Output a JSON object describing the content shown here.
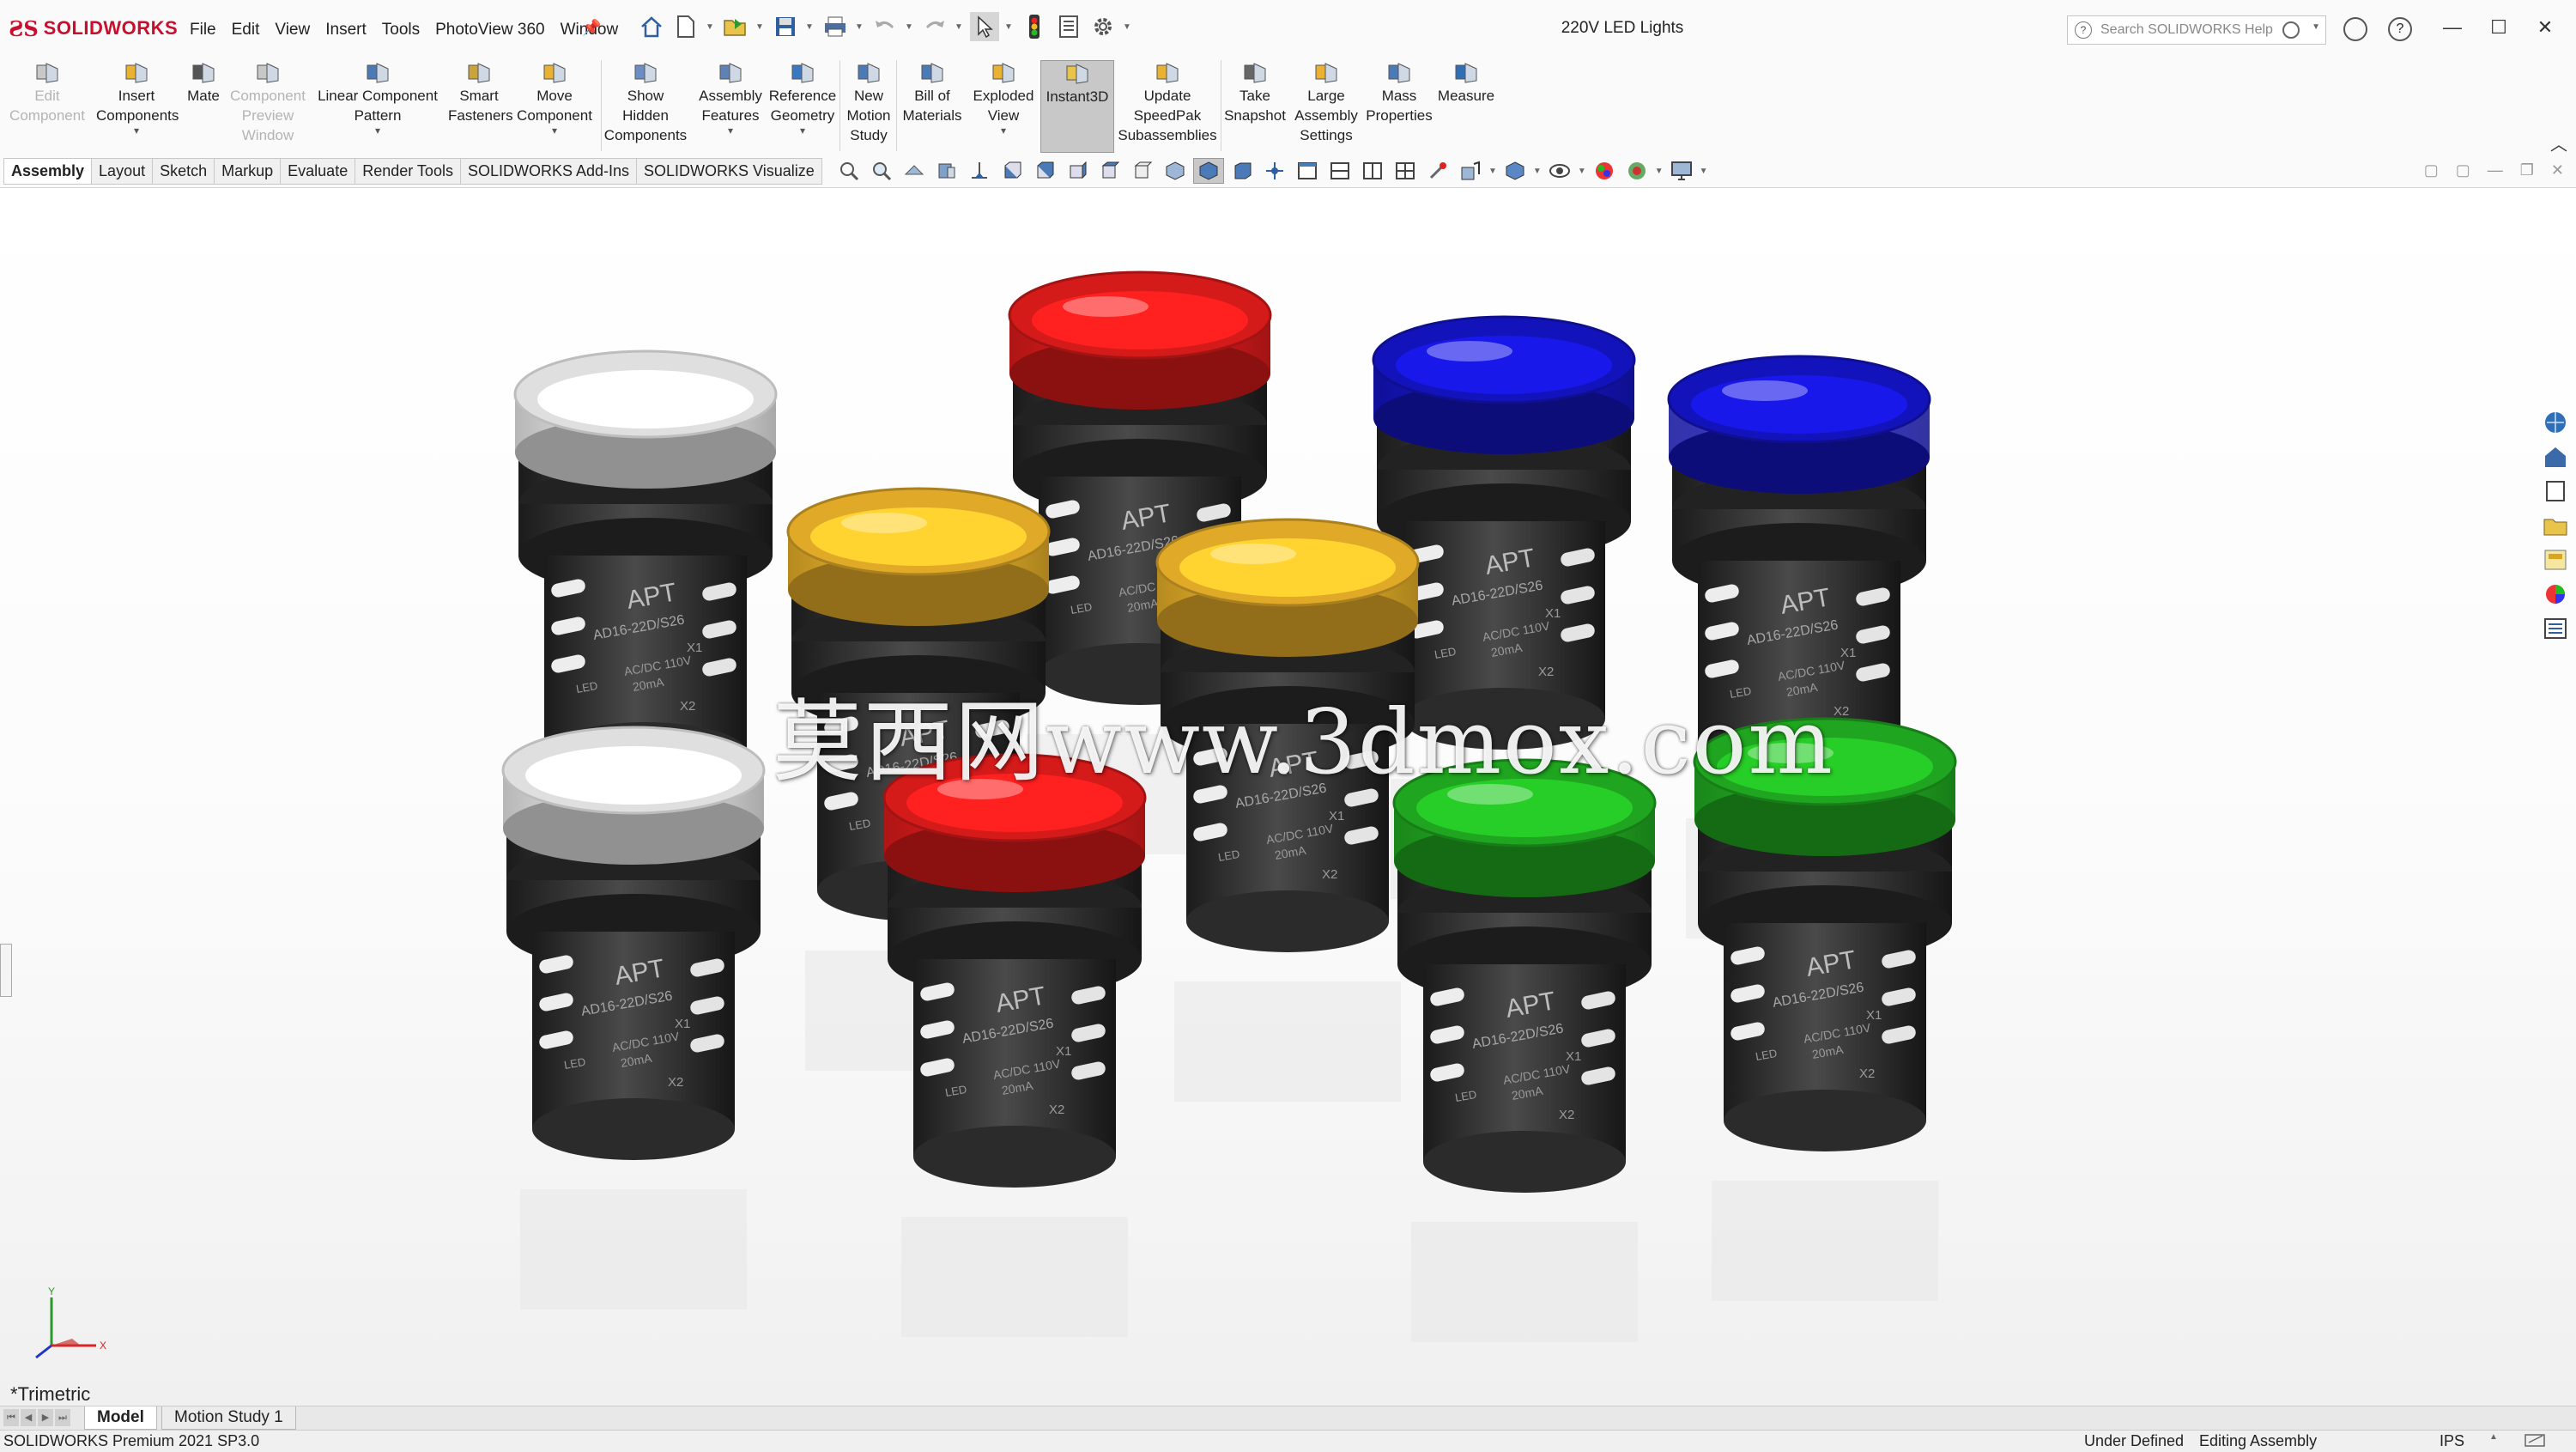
{
  "app": {
    "brand": "SOLIDWORKS",
    "doc_title": "220V LED Lights"
  },
  "menu": [
    "File",
    "Edit",
    "View",
    "Insert",
    "Tools",
    "PhotoView 360",
    "Window"
  ],
  "search": {
    "placeholder": "Search SOLIDWORKS Help"
  },
  "command_manager": [
    {
      "id": "edit-component",
      "lines": [
        "Edit",
        "Component"
      ],
      "disabled": true,
      "icon": "edit-component-icon"
    },
    {
      "id": "insert-components",
      "lines": [
        "Insert",
        "Components"
      ],
      "dropdown": true,
      "icon": "insert-components-icon"
    },
    {
      "id": "mate",
      "lines": [
        "Mate"
      ],
      "icon": "mate-paperclip-icon"
    },
    {
      "id": "component-preview-window",
      "lines": [
        "Component",
        "Preview",
        "Window"
      ],
      "disabled": true,
      "icon": "component-preview-icon"
    },
    {
      "id": "linear-component-pattern",
      "lines": [
        "Linear Component",
        "Pattern"
      ],
      "dropdown": true,
      "icon": "linear-pattern-icon"
    },
    {
      "id": "smart-fasteners",
      "lines": [
        "Smart",
        "Fasteners"
      ],
      "icon": "smart-fasteners-icon"
    },
    {
      "id": "move-component",
      "lines": [
        "Move",
        "Component"
      ],
      "dropdown": true,
      "icon": "move-component-icon"
    },
    {
      "id": "show-hidden-components",
      "lines": [
        "Show",
        "Hidden",
        "Components"
      ],
      "icon": "show-hidden-icon"
    },
    {
      "id": "assembly-features",
      "lines": [
        "Assembly",
        "Features"
      ],
      "dropdown": true,
      "icon": "assembly-features-icon"
    },
    {
      "id": "reference-geometry",
      "lines": [
        "Reference",
        "Geometry"
      ],
      "dropdown": true,
      "icon": "reference-geometry-icon"
    },
    {
      "id": "new-motion-study",
      "lines": [
        "New",
        "Motion",
        "Study"
      ],
      "icon": "motion-study-icon"
    },
    {
      "id": "bill-of-materials",
      "lines": [
        "Bill of",
        "Materials"
      ],
      "icon": "bom-icon"
    },
    {
      "id": "exploded-view",
      "lines": [
        "Exploded",
        "View"
      ],
      "dropdown": true,
      "icon": "exploded-view-icon"
    },
    {
      "id": "instant3d",
      "lines": [
        "Instant3D"
      ],
      "active": true,
      "icon": "instant3d-icon"
    },
    {
      "id": "update-speedpak",
      "lines": [
        "Update",
        "SpeedPak",
        "Subassemblies"
      ],
      "icon": "speedpak-icon"
    },
    {
      "id": "take-snapshot",
      "lines": [
        "Take",
        "Snapshot"
      ],
      "icon": "camera-icon"
    },
    {
      "id": "large-assembly-settings",
      "lines": [
        "Large",
        "Assembly",
        "Settings"
      ],
      "icon": "large-assembly-icon"
    },
    {
      "id": "mass-properties",
      "lines": [
        "Mass",
        "Properties"
      ],
      "icon": "scale-icon"
    },
    {
      "id": "measure",
      "lines": [
        "Measure"
      ],
      "icon": "measure-icon"
    }
  ],
  "tabs": [
    "Assembly",
    "Layout",
    "Sketch",
    "Markup",
    "Evaluate",
    "Render Tools",
    "SOLIDWORKS Add-Ins",
    "SOLIDWORKS Visualize"
  ],
  "active_tab": "Assembly",
  "viewport": {
    "watermark": "莫西网www.3dmox.com",
    "view_name": "*Trimetric",
    "part_brand": "APT",
    "part_model": "AD16-22D/S26",
    "terminal_1": "X1",
    "terminal_2": "X2",
    "part_rating": "AC/DC 110V",
    "part_current": "20mA",
    "part_led": "LED",
    "triad_x": "X",
    "triad_y": "Y",
    "light_colors": {
      "white": "#f2f2f2",
      "red": "#e81c1c",
      "yellow": "#f3b82b",
      "blue": "#1515cc",
      "green": "#22b322",
      "body": "#2a2a2a"
    }
  },
  "bottom_tabs": [
    "Model",
    "Motion Study 1"
  ],
  "active_bottom_tab": "Model",
  "status": {
    "product": "SOLIDWORKS Premium 2021 SP3.0",
    "state": "Under Defined",
    "mode": "Editing Assembly",
    "units": "IPS"
  }
}
